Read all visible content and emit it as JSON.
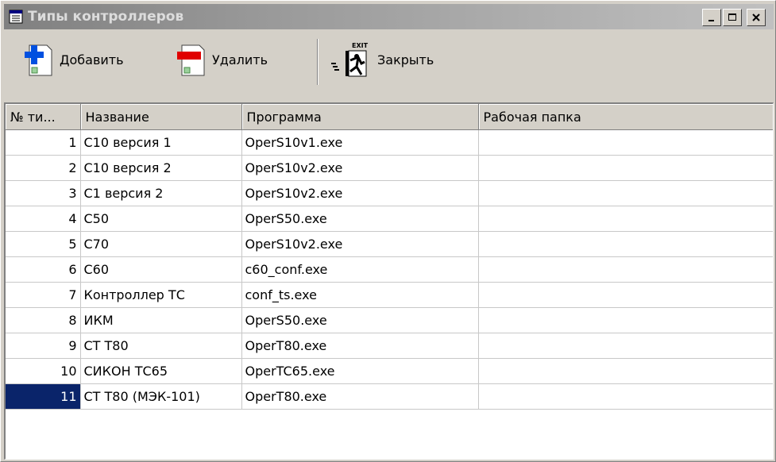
{
  "window": {
    "title": "Типы контроллеров"
  },
  "toolbar": {
    "add_label": "Добавить",
    "delete_label": "Удалить",
    "close_label": "Закрыть",
    "exit_caption": "EXIT"
  },
  "table": {
    "columns": [
      "№ ти...",
      "Название",
      "Программа",
      "Рабочая папка"
    ],
    "rows": [
      {
        "num": "1",
        "name": "C10 версия 1",
        "program": "OperS10v1.exe",
        "folder": ""
      },
      {
        "num": "2",
        "name": "C10 версия 2",
        "program": "OperS10v2.exe",
        "folder": ""
      },
      {
        "num": "3",
        "name": "C1 версия 2",
        "program": "OperS10v2.exe",
        "folder": ""
      },
      {
        "num": "4",
        "name": "C50",
        "program": "OperS50.exe",
        "folder": ""
      },
      {
        "num": "5",
        "name": "C70",
        "program": "OperS10v2.exe",
        "folder": ""
      },
      {
        "num": "6",
        "name": "C60",
        "program": "c60_conf.exe",
        "folder": ""
      },
      {
        "num": "7",
        "name": "Контроллер ТС",
        "program": "conf_ts.exe",
        "folder": ""
      },
      {
        "num": "8",
        "name": "ИКМ",
        "program": "OperS50.exe",
        "folder": ""
      },
      {
        "num": "9",
        "name": "CT T80",
        "program": "OperT80.exe",
        "folder": ""
      },
      {
        "num": "10",
        "name": "СИКОН ТС65",
        "program": "OperTC65.exe",
        "folder": ""
      },
      {
        "num": "11",
        "name": "CT T80 (МЭК-101)",
        "program": "OperT80.exe",
        "folder": ""
      }
    ],
    "selected_row": 10
  },
  "colors": {
    "selection": "#0a246a",
    "face": "#d4d0c8"
  },
  "icons": [
    "window-icon",
    "add-document-icon",
    "delete-document-icon",
    "exit-icon",
    "minimize-icon",
    "maximize-icon",
    "close-icon"
  ]
}
